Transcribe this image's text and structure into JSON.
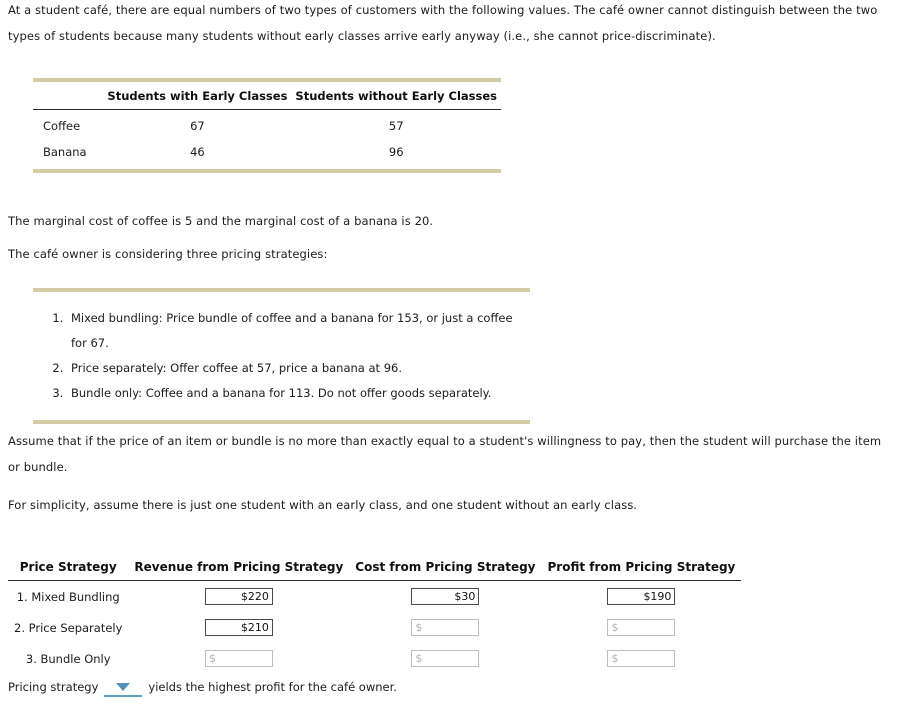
{
  "intro": {
    "paragraph": "At a student café, there are equal numbers of two types of customers with the following values. The café owner cannot distinguish between the two types of students because many students without early classes arrive early anyway (i.e., she cannot price-discriminate)."
  },
  "values_table": {
    "row_header_blank": "",
    "columns": [
      "Students with Early Classes",
      "Students without Early Classes"
    ],
    "rows": [
      {
        "label": "Coffee",
        "with_early": "67",
        "without_early": "57"
      },
      {
        "label": "Banana",
        "with_early": "46",
        "without_early": "96"
      }
    ]
  },
  "costs": {
    "marginal_cost_line": "The marginal cost of coffee is 5 and the marginal cost of a banana is 20.",
    "strategies_intro": "The café owner is considering three pricing strategies:"
  },
  "strategies": {
    "items": [
      "Mixed bundling: Price bundle of coffee and a banana for 153, or just a coffee for 67.",
      "Price separately: Offer coffee at 57, price a banana at 96.",
      "Bundle only: Coffee and a banana for 113. Do not offer goods separately."
    ]
  },
  "assumptions": {
    "purchase_rule": "Assume that if the price of an item or bundle is no more than exactly equal to a student's willingness to pay, then the student will purchase the item or bundle.",
    "simplicity": "For simplicity, assume there is just one student with an early class, and one student without an early class."
  },
  "answer_table": {
    "columns": [
      "Price Strategy",
      "Revenue from Pricing Strategy",
      "Cost from Pricing Strategy",
      "Profit from Pricing Strategy"
    ],
    "placeholder": "$",
    "rows": [
      {
        "label": "1. Mixed Bundling",
        "revenue": "$220",
        "revenue_filled": true,
        "cost": "$30",
        "cost_filled": true,
        "profit": "$190",
        "profit_filled": true
      },
      {
        "label": "2. Price Separately",
        "revenue": "$210",
        "revenue_filled": true,
        "cost": "",
        "cost_filled": false,
        "profit": "",
        "profit_filled": false
      },
      {
        "label": "3. Bundle Only",
        "revenue": "",
        "revenue_filled": false,
        "cost": "",
        "cost_filled": false,
        "profit": "",
        "profit_filled": false
      }
    ]
  },
  "conclusion": {
    "prefix": "Pricing strategy",
    "dropdown_value": "",
    "suffix": "yields the highest profit for the café owner."
  },
  "colors": {
    "table_rule_tan": "#d2cba4",
    "header_rule_black": "#2b2b2b",
    "dropdown_blue": "#4f94b8",
    "input_filled_border": "#4a4a4a",
    "input_empty_border": "#bdbdbd",
    "placeholder_gray": "#b3b3b3"
  }
}
